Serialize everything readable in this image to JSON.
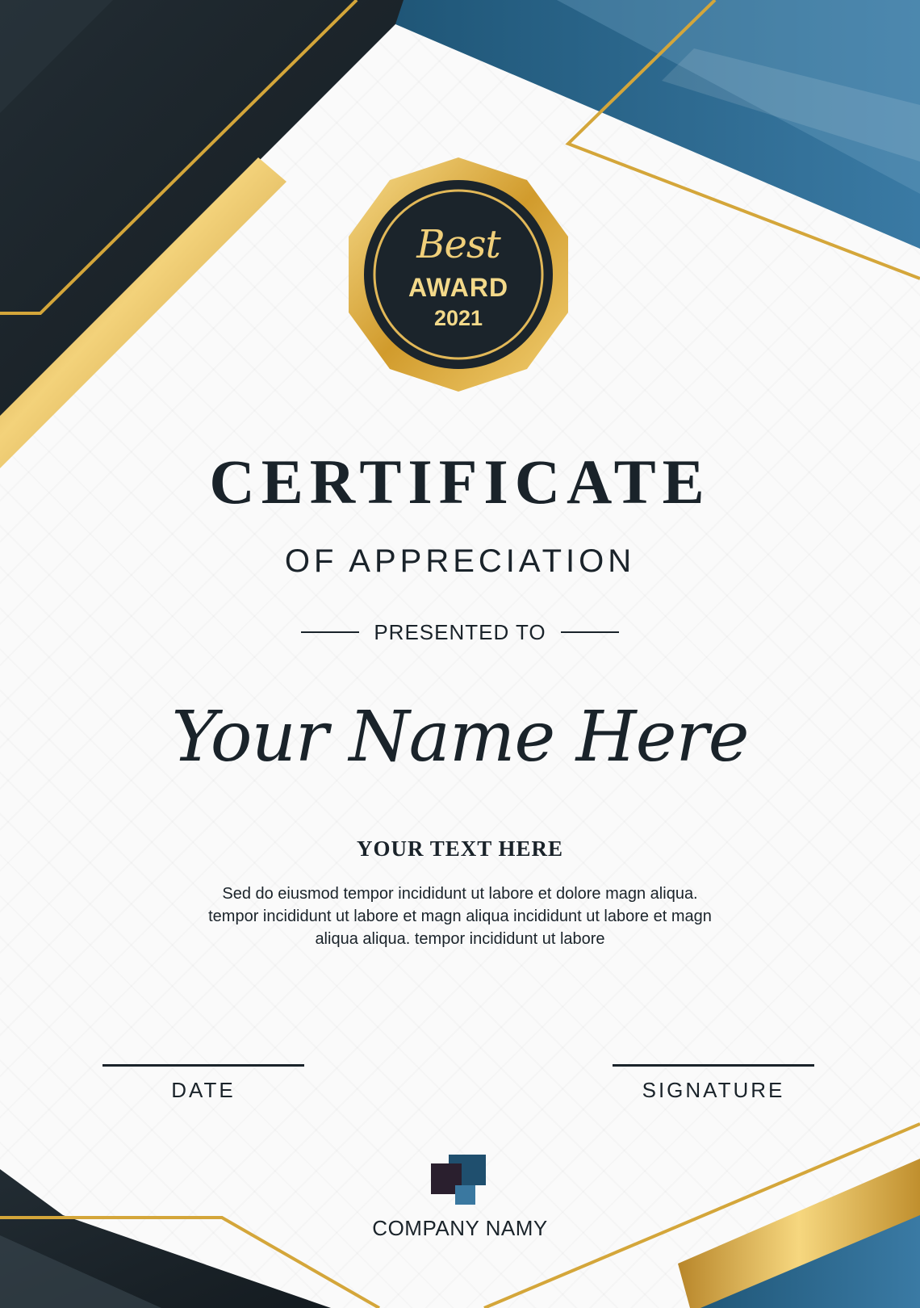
{
  "badge": {
    "best": "Best",
    "award": "AWARD",
    "year": "2021"
  },
  "certificate": {
    "title": "CERTIFICATE",
    "subtitle": "OF APPRECIATION",
    "presented_to": "PRESENTED TO",
    "recipient_name": "Your Name Here",
    "text_heading": "YOUR TEXT HERE",
    "body_lines": [
      "Sed do eiusmod tempor incididunt ut labore et dolore magn aliqua.",
      "tempor incididunt ut labore et  magn aliqua incididunt ut labore et  magn",
      "aliqua aliqua. tempor incididunt ut labore"
    ]
  },
  "footer": {
    "date_label": "DATE",
    "signature_label": "SIGNATURE",
    "company_name": "COMPANY NAMY"
  },
  "colors": {
    "navy": "#1b242b",
    "blue": "#2b6388",
    "gold": "#d4a63a",
    "text": "#1a232a"
  }
}
